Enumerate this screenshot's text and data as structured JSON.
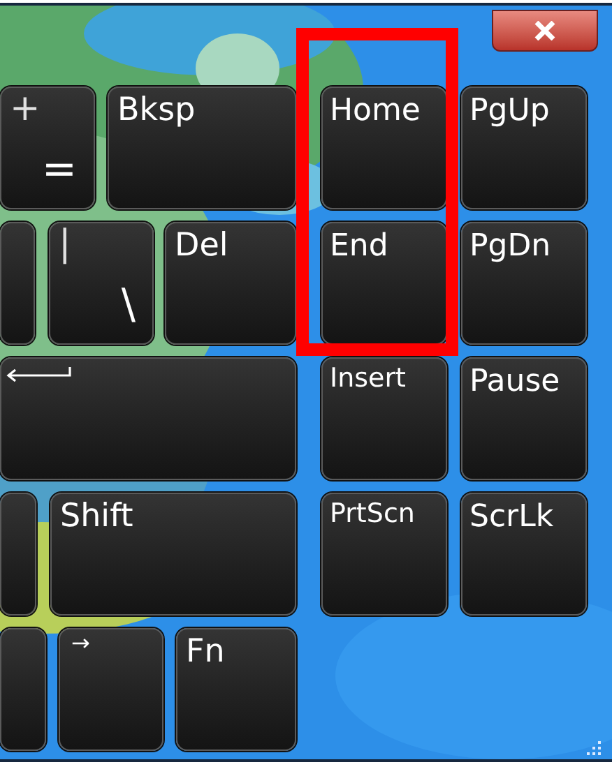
{
  "keyboard": {
    "rows": [
      {
        "left": [
          {
            "kind": "dual",
            "top": "+",
            "bottom": "="
          },
          {
            "kind": "text",
            "label": "Bksp"
          }
        ],
        "right": [
          {
            "label": "Home",
            "highlighted": true
          },
          {
            "label": "PgUp",
            "highlighted": false
          }
        ]
      },
      {
        "left": [
          {
            "kind": "blank"
          },
          {
            "kind": "dual",
            "top": "|",
            "bottom": "\\"
          },
          {
            "kind": "text",
            "label": "Del"
          }
        ],
        "right": [
          {
            "label": "End",
            "highlighted": true
          },
          {
            "label": "PgDn",
            "highlighted": false
          }
        ]
      },
      {
        "left": [
          {
            "kind": "enter"
          }
        ],
        "right": [
          {
            "label": "Insert",
            "highlighted": false
          },
          {
            "label": "Pause",
            "highlighted": false
          }
        ]
      },
      {
        "left": [
          {
            "kind": "blank"
          },
          {
            "kind": "text",
            "label": "Shift"
          }
        ],
        "right": [
          {
            "label": "PrtScn",
            "highlighted": false
          },
          {
            "label": "ScrLk",
            "highlighted": false
          }
        ]
      },
      {
        "left": [
          {
            "kind": "blank"
          },
          {
            "kind": "small",
            "label": "→"
          },
          {
            "kind": "text",
            "label": "Fn"
          }
        ],
        "right": []
      }
    ]
  }
}
